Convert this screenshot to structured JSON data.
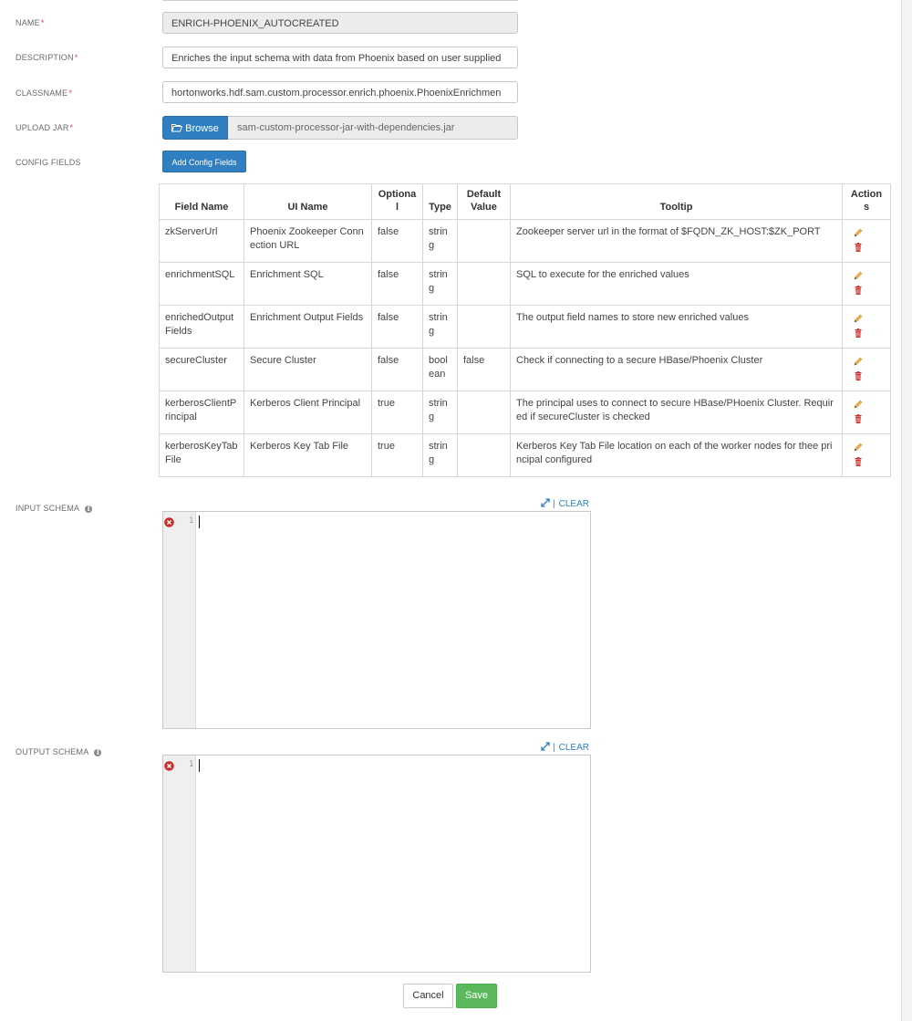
{
  "form": {
    "name": {
      "label": "NAME",
      "required_mark": "*",
      "value": "ENRICH-PHOENIX_AUTOCREATED"
    },
    "description": {
      "label": "DESCRIPTION",
      "required_mark": "*",
      "value": "Enriches the input schema with data from Phoenix based on user supplied"
    },
    "classname": {
      "label": "CLASSNAME",
      "required_mark": "*",
      "value": "hortonworks.hdf.sam.custom.processor.enrich.phoenix.PhoenixEnrichmen"
    },
    "upload_jar": {
      "label": "UPLOAD JAR",
      "required_mark": "*",
      "browse_label": "Browse",
      "file_name": "sam-custom-processor-jar-with-dependencies.jar"
    },
    "config_fields": {
      "label": "CONFIG FIELDS",
      "add_button_label": "Add Config Fields"
    }
  },
  "config_table": {
    "headers": {
      "field_name": "Field Name",
      "ui_name": "UI Name",
      "optional": "Optional",
      "type": "Type",
      "default_value": "Default Value",
      "tooltip": "Tooltip",
      "actions": "Actions"
    },
    "rows": [
      {
        "field_name": "zkServerUrl",
        "ui_name": "Phoenix Zookeeper Connection URL",
        "optional": "false",
        "type": "string",
        "default_value": "",
        "tooltip": "Zookeeper server url in the format of $FQDN_ZK_HOST:$ZK_PORT"
      },
      {
        "field_name": "enrichmentSQL",
        "ui_name": "Enrichment SQL",
        "optional": "false",
        "type": "string",
        "default_value": "",
        "tooltip": "SQL to execute for the enriched values"
      },
      {
        "field_name": "enrichedOutputFields",
        "ui_name": "Enrichment Output Fields",
        "optional": "false",
        "type": "string",
        "default_value": "",
        "tooltip": "The output field names to store new enriched values"
      },
      {
        "field_name": "secureCluster",
        "ui_name": "Secure Cluster",
        "optional": "false",
        "type": "boolean",
        "default_value": "false",
        "tooltip": "Check if connecting to a secure HBase/Phoenix Cluster"
      },
      {
        "field_name": "kerberosClientPrincipal",
        "ui_name": "Kerberos Client Principal",
        "optional": "true",
        "type": "string",
        "default_value": "",
        "tooltip": "The principal uses to connect to secure HBase/PHoenix Cluster. Required if secureCluster is checked"
      },
      {
        "field_name": "kerberosKeyTabFile",
        "ui_name": "Kerberos Key Tab File",
        "optional": "true",
        "type": "string",
        "default_value": "",
        "tooltip": "Kerberos Key Tab File location on each of the worker nodes for thee principal configured"
      }
    ]
  },
  "input_schema": {
    "label": "INPUT SCHEMA",
    "clear_label": "CLEAR",
    "separator": "|",
    "line_number": "1"
  },
  "output_schema": {
    "label": "OUTPUT SCHEMA",
    "clear_label": "CLEAR",
    "separator": "|",
    "line_number": "1"
  },
  "footer": {
    "cancel_label": "Cancel",
    "save_label": "Save"
  },
  "colors": {
    "primary": "#2f7fc1",
    "success": "#5cb85c",
    "required": "#e04646",
    "error": "#c9302c",
    "edit_icon": "#f0ad4e"
  }
}
